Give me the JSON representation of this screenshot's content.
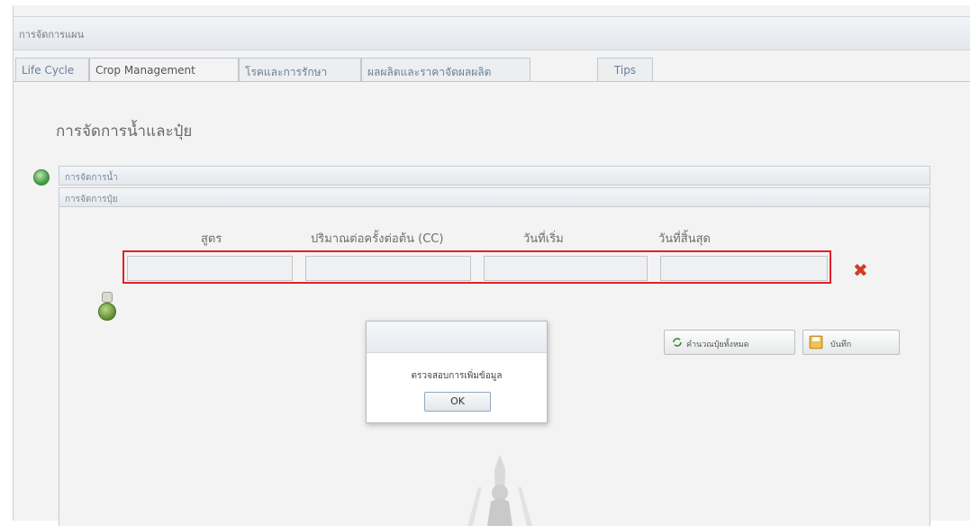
{
  "app": {
    "title": "การจัดการแผน"
  },
  "tabs": [
    {
      "label": "Life Cycle",
      "active": false
    },
    {
      "label": "Crop Management",
      "active": true
    },
    {
      "label": "โรคและการรักษา",
      "active": false
    },
    {
      "label": "ผลผลิตและราคาจัดผลผลิต",
      "active": false
    },
    {
      "label": "Tips",
      "active": false
    }
  ],
  "panel": {
    "heading": "การจัดการน้ำและปุ๋ย",
    "sections": [
      {
        "label": "การจัดการน้ำ"
      },
      {
        "label": "การจัดการปุ๋ย"
      }
    ]
  },
  "fertilizer_table": {
    "columns": [
      "สูตร",
      "ปริมาณต่อครั้งต่อต้น (CC)",
      "วันที่เริ่ม",
      "วันที่สิ้นสุด"
    ],
    "row": {
      "formula": "",
      "amount": "",
      "start_date": "",
      "end_date": ""
    }
  },
  "buttons": {
    "calc_label": "คำนวณปุ๋ยทั้งหมด",
    "save_label": "บันทึก"
  },
  "dialog": {
    "message": "ตรวจสอบการเพิ่มข้อมูล",
    "ok_label": "OK"
  },
  "colors": {
    "highlight": "#e0202a",
    "delete": "#d03c2a",
    "tab_text": "#6a7f96"
  }
}
